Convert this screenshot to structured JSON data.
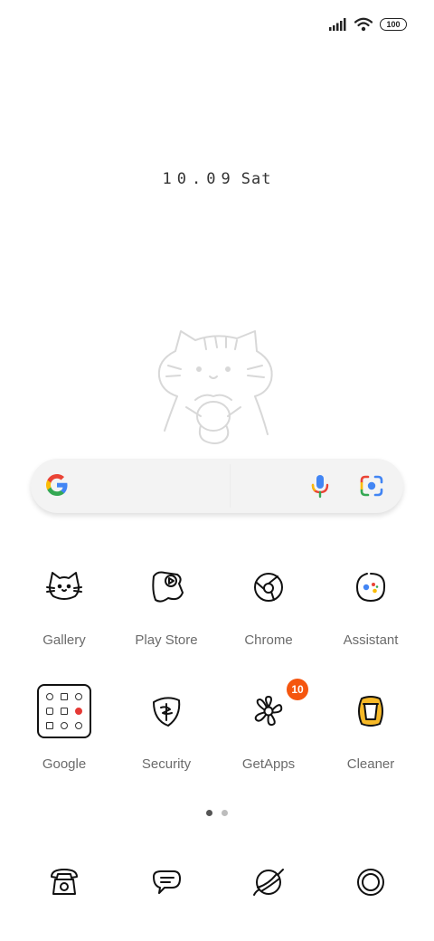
{
  "status_bar": {
    "signal_icon": "signal-bars-icon",
    "wifi_icon": "wifi-icon",
    "battery_level": "100"
  },
  "clock": {
    "time": "10.09",
    "day": "Sat"
  },
  "search_bar": {
    "google_icon": "google-g-icon",
    "mic_icon": "microphone-icon",
    "lens_icon": "google-lens-icon"
  },
  "apps": [
    {
      "label": "Gallery",
      "icon": "cat-face-icon"
    },
    {
      "label": "Play Store",
      "icon": "play-store-icon"
    },
    {
      "label": "Chrome",
      "icon": "chrome-icon"
    },
    {
      "label": "Assistant",
      "icon": "assistant-icon"
    },
    {
      "label": "Google",
      "icon": "folder-icon"
    },
    {
      "label": "Security",
      "icon": "security-shield-icon"
    },
    {
      "label": "GetApps",
      "icon": "flower-icon",
      "badge": "10"
    },
    {
      "label": "Cleaner",
      "icon": "trash-can-icon"
    }
  ],
  "page_indicator": {
    "pages": 2,
    "current": 1
  },
  "dock": [
    {
      "icon": "phone-icon"
    },
    {
      "icon": "messages-icon"
    },
    {
      "icon": "browser-planet-icon"
    },
    {
      "icon": "camera-icon"
    }
  ],
  "colors": {
    "badge": "#f5560f",
    "label": "#6b6b6b",
    "search_bg": "#f3f3f3",
    "dot_active": "#555555",
    "dot_inactive": "#bdbdbd"
  }
}
